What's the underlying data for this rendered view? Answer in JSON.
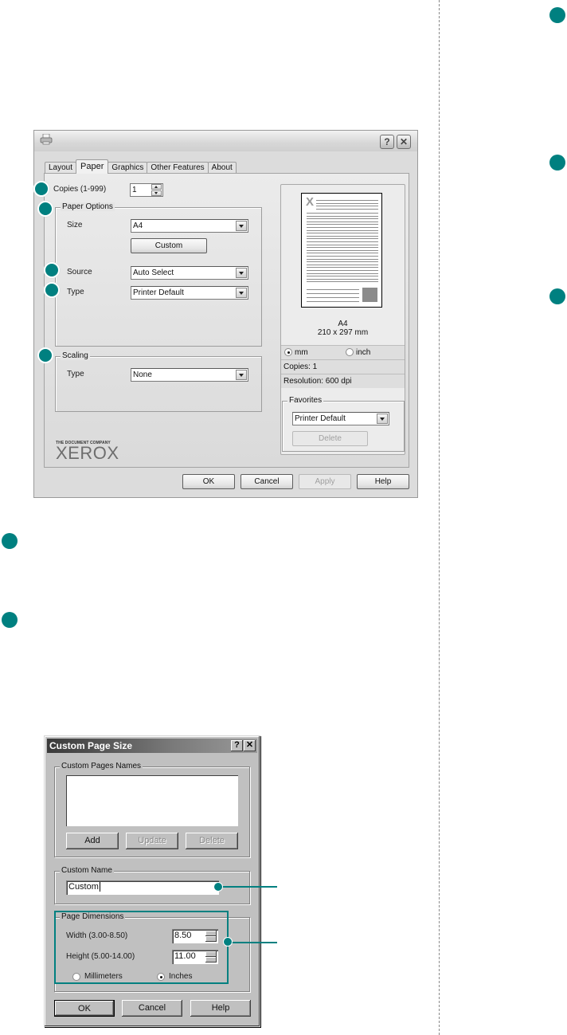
{
  "colors": {
    "accent": "#008080",
    "divider": "#8a8a8a"
  },
  "printer_properties": {
    "title_icon": "printer-icon",
    "title_buttons": {
      "help": "?",
      "close": "✕"
    },
    "tabs": [
      {
        "label": "Layout",
        "active": false
      },
      {
        "label": "Paper",
        "active": true
      },
      {
        "label": "Graphics",
        "active": false
      },
      {
        "label": "Other Features",
        "active": false
      },
      {
        "label": "About",
        "active": false
      }
    ],
    "copies": {
      "label": "Copies (1-999)",
      "value": "1"
    },
    "paper_options": {
      "legend": "Paper Options",
      "size_label": "Size",
      "size_value": "A4",
      "custom_button": "Custom",
      "source_label": "Source",
      "source_value": "Auto Select",
      "type_label": "Type",
      "type_value": "Printer Default"
    },
    "scaling": {
      "legend": "Scaling",
      "type_label": "Type",
      "type_value": "None"
    },
    "brand": {
      "tagline": "THE DOCUMENT COMPANY",
      "name": "XEROX"
    },
    "preview": {
      "paper_name": "A4",
      "paper_dims": "210 x 297 mm",
      "unit_mm": "mm",
      "unit_inch": "inch",
      "selected_unit": "mm",
      "copies": "Copies: 1",
      "resolution": "Resolution: 600 dpi"
    },
    "favorites": {
      "legend": "Favorites",
      "value": "Printer Default",
      "delete_button": "Delete"
    },
    "buttons": {
      "ok": "OK",
      "cancel": "Cancel",
      "apply": "Apply",
      "help": "Help"
    }
  },
  "custom_page_size": {
    "title": "Custom Page Size",
    "title_buttons": {
      "help": "?",
      "close": "✕"
    },
    "names_group": {
      "legend": "Custom Pages Names",
      "items": []
    },
    "list_buttons": {
      "add": "Add",
      "update": "Update",
      "delete": "Delete"
    },
    "custom_name": {
      "legend": "Custom Name",
      "value": "Custom"
    },
    "page_dimensions": {
      "legend": "Page Dimensions",
      "width_label": "Width (3.00-8.50)",
      "width_value": "8.50",
      "height_label": "Height (5.00-14.00)",
      "height_value": "11.00",
      "unit_mm": "Millimeters",
      "unit_in": "Inches",
      "selected_unit": "Inches"
    },
    "buttons": {
      "ok": "OK",
      "cancel": "Cancel",
      "help": "Help"
    }
  }
}
